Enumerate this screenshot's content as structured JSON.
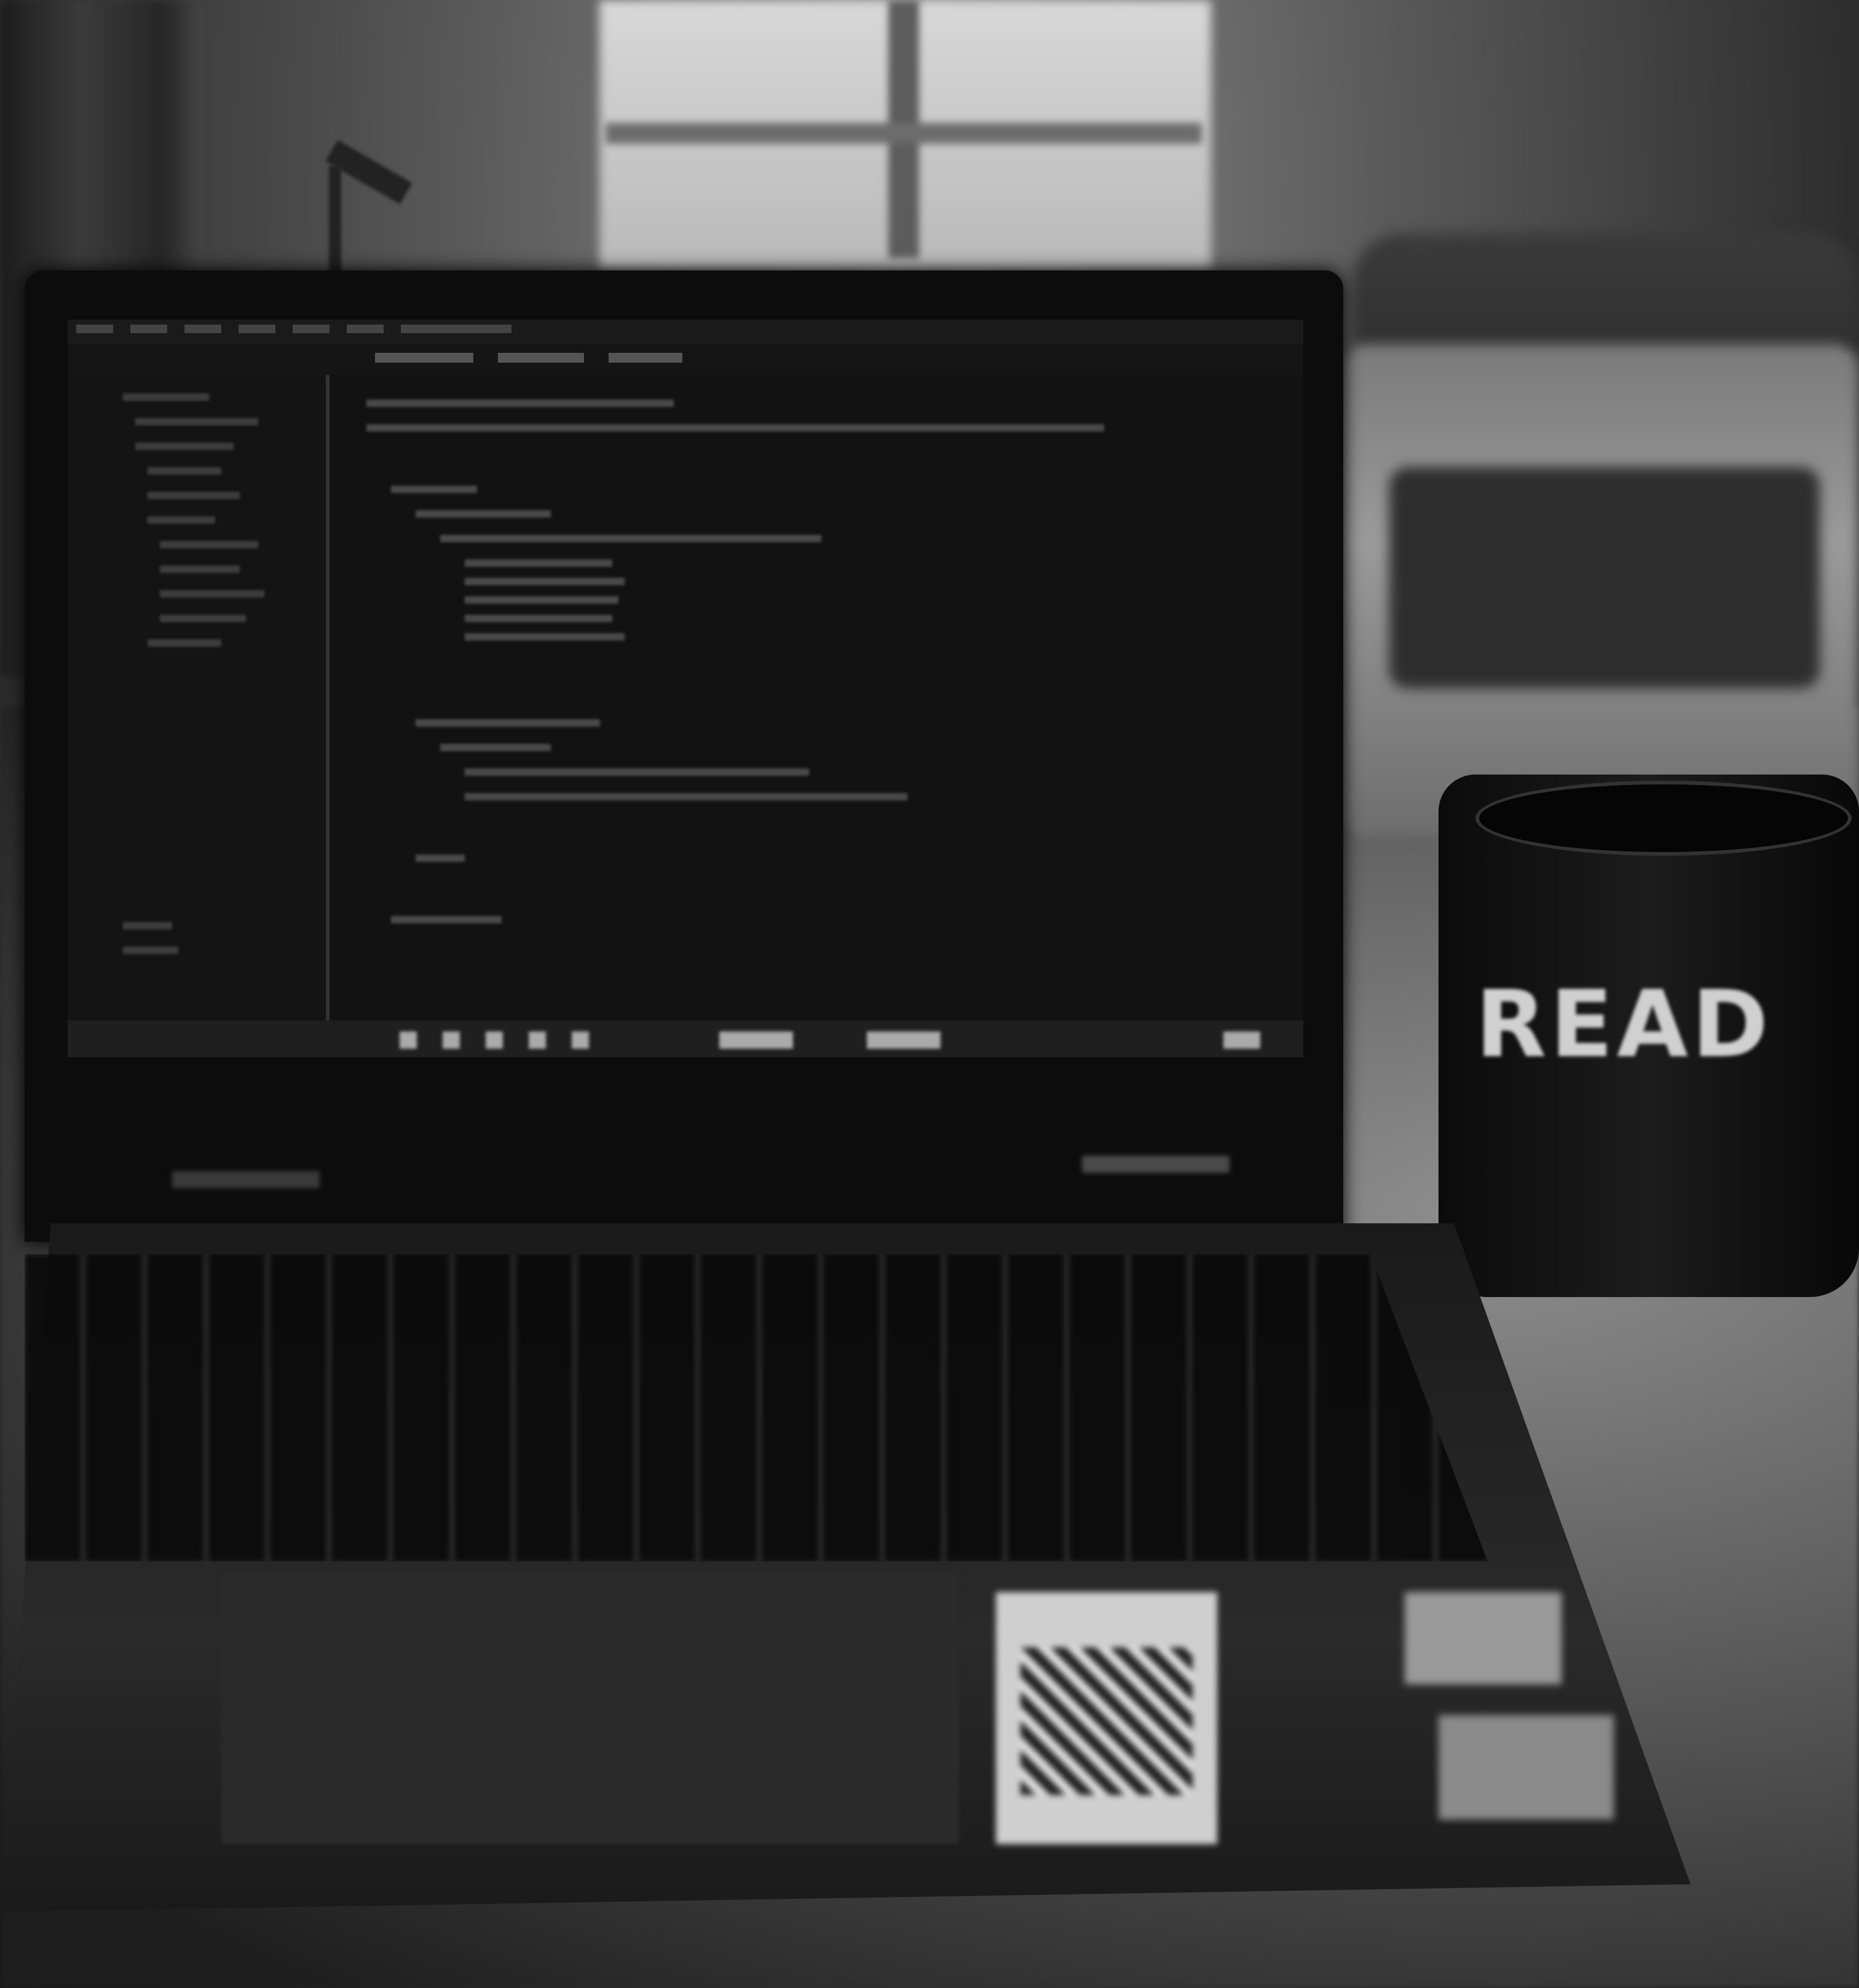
{
  "scene": {
    "mug": {
      "text": "READ"
    },
    "laptop": {
      "screen": {
        "app": "code-editor"
      }
    }
  }
}
